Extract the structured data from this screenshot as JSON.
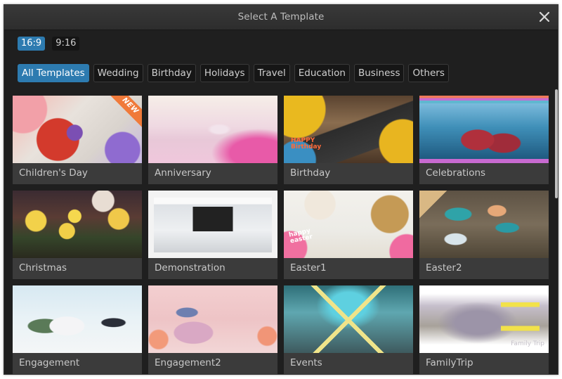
{
  "dialog": {
    "title": "Select A Template",
    "close_icon": "close-icon"
  },
  "aspect_ratios": [
    {
      "label": "16:9",
      "active": true
    },
    {
      "label": "9:16",
      "active": false
    }
  ],
  "categories": [
    {
      "label": "All Templates",
      "active": true
    },
    {
      "label": "Wedding",
      "active": false
    },
    {
      "label": "Birthday",
      "active": false
    },
    {
      "label": "Holidays",
      "active": false
    },
    {
      "label": "Travel",
      "active": false
    },
    {
      "label": "Education",
      "active": false
    },
    {
      "label": "Business",
      "active": false
    },
    {
      "label": "Others",
      "active": false
    }
  ],
  "templates": [
    {
      "name": "Children's Day",
      "badge": "NEW"
    },
    {
      "name": "Anniversary"
    },
    {
      "name": "Birthday",
      "overlay": "HAPPY Birthday"
    },
    {
      "name": "Celebrations"
    },
    {
      "name": "Christmas"
    },
    {
      "name": "Demonstration"
    },
    {
      "name": "Easter1",
      "overlay": "happy easter"
    },
    {
      "name": "Easter2"
    },
    {
      "name": "Engagement"
    },
    {
      "name": "Engagement2"
    },
    {
      "name": "Events"
    },
    {
      "name": "FamilyTrip",
      "overlay": "Family Trip"
    }
  ],
  "colors": {
    "accent": "#2d7bb0",
    "background": "#1f1f1f",
    "card": "#3b3b3b",
    "new_badge": "#f07a3a"
  }
}
